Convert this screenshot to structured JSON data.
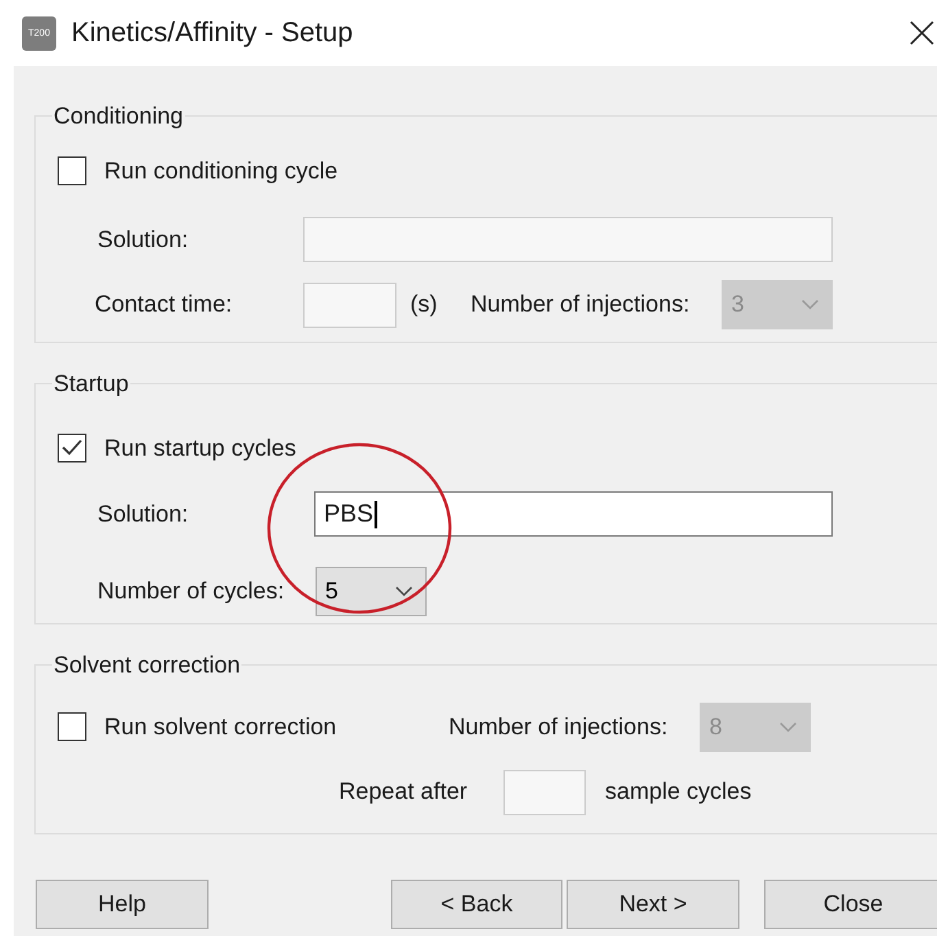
{
  "window": {
    "icon_label": "T200",
    "title": "Kinetics/Affinity - Setup"
  },
  "conditioning": {
    "title": "Conditioning",
    "run": {
      "label": "Run conditioning cycle",
      "checked": false
    },
    "solution": {
      "label": "Solution:",
      "disabled": true
    },
    "contact_time": {
      "label": "Contact time:",
      "unit": "(s)",
      "disabled": true
    },
    "injections": {
      "label": "Number of injections:",
      "value": "3",
      "disabled": true
    }
  },
  "startup": {
    "title": "Startup",
    "run": {
      "label": "Run startup cycles",
      "checked": true
    },
    "solution": {
      "label": "Solution:",
      "value": "PBS",
      "disabled": false,
      "focused": true
    },
    "cycles": {
      "label": "Number of cycles:",
      "value": "5",
      "disabled": false
    }
  },
  "solvent_correction": {
    "title": "Solvent correction",
    "run": {
      "label": "Run solvent correction",
      "checked": false
    },
    "injections": {
      "label": "Number of injections:",
      "value": "8",
      "disabled": true
    },
    "repeat": {
      "label": "Repeat after",
      "unit": "sample cycles",
      "disabled": true
    }
  },
  "buttons": [
    {
      "label": "Help"
    },
    {
      "label": "< Back"
    },
    {
      "label": "Next >"
    },
    {
      "label": "Close"
    }
  ]
}
